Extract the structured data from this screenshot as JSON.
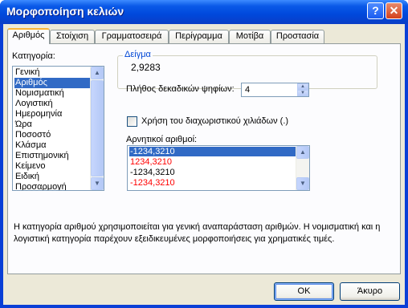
{
  "window": {
    "title": "Μορφοποίηση κελιών",
    "help_glyph": "?",
    "close_glyph": "✕"
  },
  "tabs": [
    {
      "label": "Αριθμός",
      "active": true
    },
    {
      "label": "Στοίχιση"
    },
    {
      "label": "Γραμματοσειρά"
    },
    {
      "label": "Περίγραμμα"
    },
    {
      "label": "Μοτίβα"
    },
    {
      "label": "Προστασία"
    }
  ],
  "category": {
    "label": "Κατηγορία:",
    "items": [
      "Γενική",
      "Αριθμός",
      "Νομισματική",
      "Λογιστική",
      "Ημερομηνία",
      "Ώρα",
      "Ποσοστό",
      "Κλάσμα",
      "Επιστημονική",
      "Κείμενο",
      "Ειδική",
      "Προσαρμογή"
    ],
    "selected": "Αριθμός"
  },
  "sample": {
    "label": "Δείγμα",
    "value": "2,9283"
  },
  "decimals": {
    "label": "Πλήθος δεκαδικών ψηφίων:",
    "value": "4"
  },
  "separator": {
    "label": "Χρήση του διαχωριστικού χιλιάδων (.)",
    "checked": false
  },
  "negative": {
    "label": "Αρνητικοί αριθμοί:",
    "items": [
      {
        "text": "-1234,3210",
        "color": "#ffffff",
        "selected": true
      },
      {
        "text": "1234,3210",
        "color": "#ff0000"
      },
      {
        "text": "-1234,3210",
        "color": "#000000"
      },
      {
        "text": "-1234,3210",
        "color": "#ff0000"
      }
    ]
  },
  "description": "Η κατηγορία αριθμού χρησιμοποιείται για γενική αναπαράσταση αριθμών.  Η νομισματική και η λογιστική κατηγορία παρέχουν εξειδικευμένες μορφοποιήσεις για χρηματικές τιμές.",
  "buttons": {
    "ok": "OK",
    "cancel": "Άκυρο"
  }
}
